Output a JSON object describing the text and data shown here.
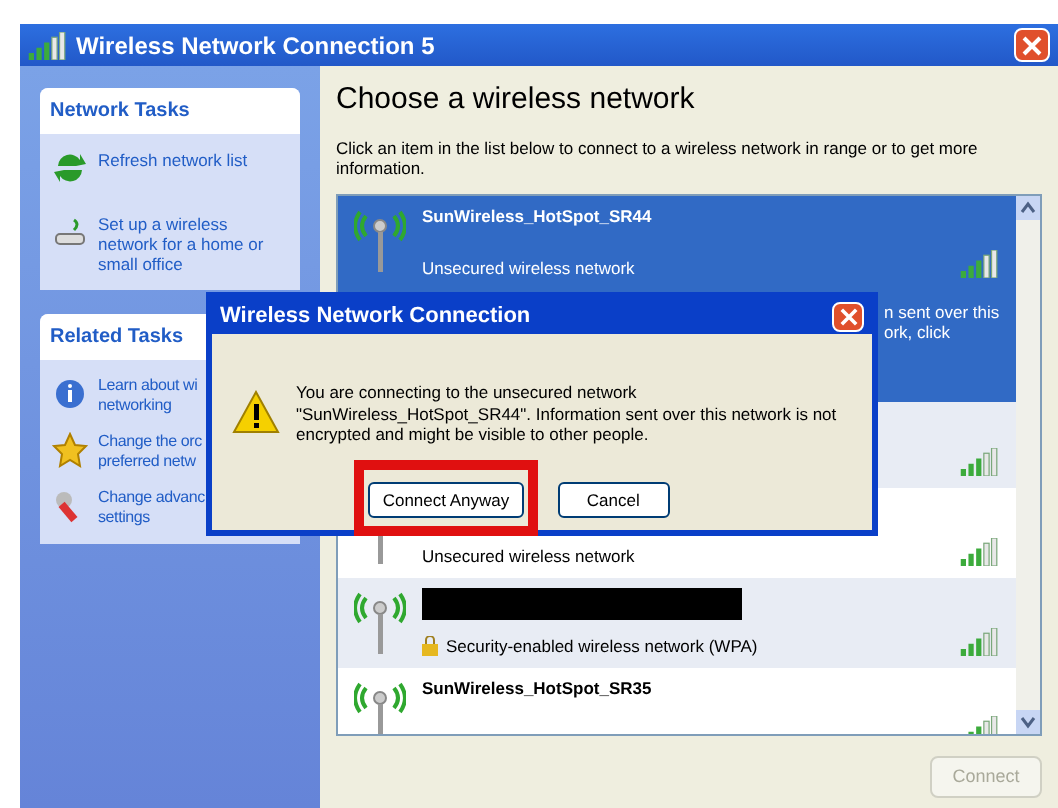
{
  "window": {
    "title": "Wireless Network Connection 5"
  },
  "network_tasks": {
    "title": "Network Tasks",
    "items": [
      {
        "label": "Refresh network list"
      },
      {
        "label": "Set up a wireless network for a home or small office"
      }
    ]
  },
  "related_tasks": {
    "title": "Related Tasks",
    "items": [
      {
        "lines": [
          "Learn about wi",
          "networking"
        ]
      },
      {
        "lines": [
          "Change the orc",
          "preferred netw"
        ]
      },
      {
        "lines": [
          "Change advanc",
          "settings"
        ]
      }
    ]
  },
  "heading": "Choose a wireless network",
  "intro": "Click an item in the list below to connect to a wireless network in range or to get more information.",
  "networks": [
    {
      "name": "SunWireless_HotSpot_SR44",
      "status": "Unsecured wireless network",
      "detail_lines": [
        "n sent over this",
        "ork, click"
      ],
      "selected": true,
      "secured": false,
      "redacted": false
    },
    {
      "selected": false
    },
    {
      "status": "Unsecured wireless network",
      "selected": false,
      "secured": false
    },
    {
      "status": "Security-enabled wireless network (WPA)",
      "selected": false,
      "secured": true,
      "redacted": true
    },
    {
      "name": "SunWireless_HotSpot_SR35",
      "selected": false,
      "secured": false,
      "redacted": false
    }
  ],
  "connect_button": {
    "label": "Connect",
    "disabled": true
  },
  "dialog": {
    "title": "Wireless Network Connection",
    "message": "You are connecting to the unsecured network \"SunWireless_HotSpot_SR44\". Information sent over this network is not encrypted and might be visible to other people.",
    "buttons": [
      {
        "label": "Connect Anyway",
        "highlighted": true
      },
      {
        "label": "Cancel",
        "highlighted": false
      }
    ]
  }
}
